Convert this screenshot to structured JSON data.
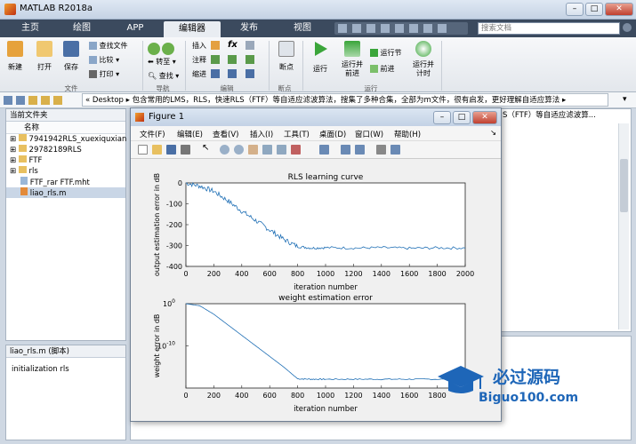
{
  "window": {
    "title": "MATLAB R2018a",
    "search_placeholder": "搜索文档"
  },
  "tabs": [
    "主页",
    "绘图",
    "APP",
    "编辑器",
    "发布",
    "视图"
  ],
  "ribbon": {
    "new": "新建",
    "open": "打开",
    "save": "保存",
    "find_files": "查找文件",
    "compare": "比较",
    "print": "打印",
    "insert": "插入",
    "fx": "fx",
    "comment": "注释",
    "indent": "缩进",
    "goto": "转至",
    "find": "查找",
    "breakpoints": "断点",
    "run": "运行",
    "run_advance": "运行并\n前进",
    "run_section": "运行节",
    "advance": "前进",
    "run_time": "运行并\n计时",
    "groups": {
      "file": "文件",
      "navigate": "导航",
      "edit": "编辑",
      "breakpoints": "断点",
      "run": "运行"
    }
  },
  "address": {
    "path": "« Desktop ▸ 包含常用的LMS，RLS，快速RLS（FTF）等自适应滤波算法，搜集了多种合集，全部为m文件，很有启发，更好理解自适应算法 ▸"
  },
  "current_folder": {
    "title": "当前文件夹",
    "col_name": "名称",
    "items": [
      "7941942RLS_xuexiquxian",
      "29782189RLS",
      "FTF",
      "rls",
      "FTF_rar FTF.mht",
      "liao_rls.m"
    ]
  },
  "details": {
    "title": "liao_rls.m (脚本)",
    "text": "initialization rls"
  },
  "editor_tab_text": "S（FTF）等自适应滤波算...",
  "figure": {
    "title": "Figure 1",
    "menu": [
      "文件(F)",
      "编辑(E)",
      "查看(V)",
      "插入(I)",
      "工具(T)",
      "桌面(D)",
      "窗口(W)",
      "帮助(H)"
    ]
  },
  "chart_data": [
    {
      "type": "line",
      "title": "RLS learning curve",
      "xlabel": "iteration number",
      "ylabel": "output estimation error in dB",
      "xlim": [
        0,
        2000
      ],
      "ylim": [
        -400,
        0
      ],
      "xticks": [
        0,
        200,
        400,
        600,
        800,
        1000,
        1200,
        1400,
        1600,
        1800,
        2000
      ],
      "yticks": [
        0,
        -100,
        -200,
        -300,
        -400
      ],
      "color": "#1f6fb5",
      "series": [
        {
          "x": [
            0,
            100,
            200,
            300,
            400,
            500,
            600,
            700,
            800,
            900,
            1000,
            1200,
            1400,
            1600,
            1800,
            2000
          ],
          "y": [
            0,
            -15,
            -40,
            -85,
            -135,
            -180,
            -225,
            -270,
            -305,
            -312,
            -310,
            -312,
            -310,
            -313,
            -311,
            -312
          ]
        }
      ]
    },
    {
      "type": "line",
      "title": "weight estimation error",
      "xlabel": "iteration number",
      "ylabel": "weight error in dB",
      "xlim": [
        0,
        2000
      ],
      "ylim_log": [
        -20,
        0
      ],
      "xticks": [
        0,
        200,
        400,
        600,
        800,
        1000,
        1200,
        1400,
        1600,
        1800
      ],
      "yticks": [
        "10^0",
        "10^-10"
      ],
      "color": "#1f6fb5",
      "series": [
        {
          "x": [
            0,
            100,
            200,
            300,
            400,
            500,
            600,
            700,
            800,
            900,
            1000,
            1200,
            1400,
            1600,
            1800,
            2000
          ],
          "y": [
            0,
            -0.5,
            -2.5,
            -5,
            -7.5,
            -10,
            -12.5,
            -15,
            -17.8,
            -17.9,
            -17.9,
            -17.9,
            -17.9,
            -17.9,
            -17.9,
            -17.9
          ]
        }
      ]
    }
  ],
  "watermark": {
    "brand": "必过源码",
    "url": "Biguo100.com"
  }
}
